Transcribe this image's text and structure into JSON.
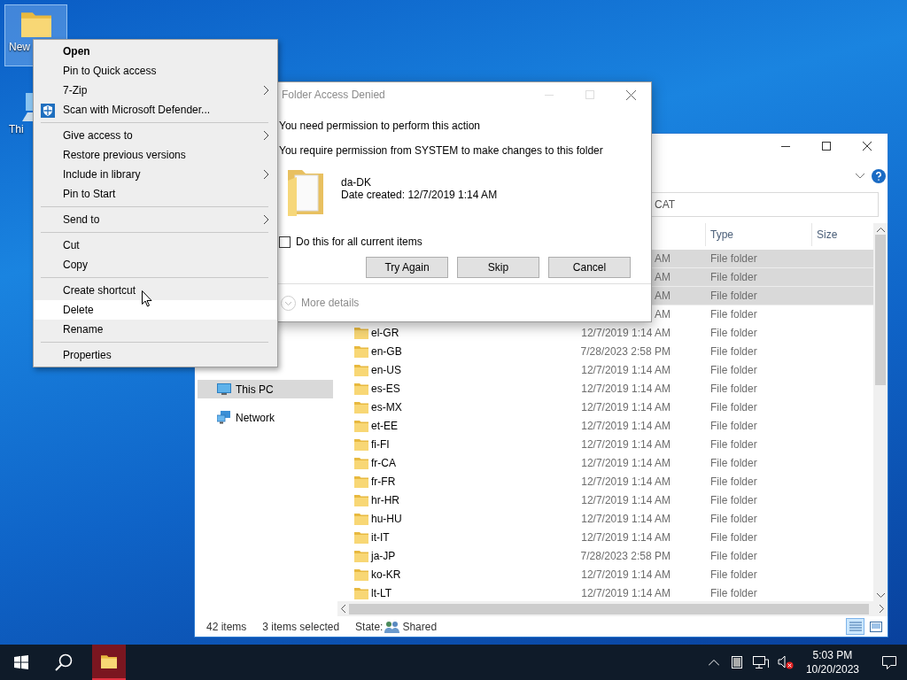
{
  "desktop": {
    "icons": [
      {
        "kind": "folder",
        "label": "New",
        "selected": true
      },
      {
        "kind": "computer",
        "label": "Thi",
        "selected": false
      }
    ]
  },
  "context_menu": {
    "groups": [
      {
        "items": [
          {
            "label": "Open",
            "default": true,
            "submenu": false,
            "highlighted": false,
            "has_icon": false
          },
          {
            "label": "Pin to Quick access",
            "default": false,
            "submenu": false,
            "highlighted": false,
            "has_icon": false
          },
          {
            "label": "7-Zip",
            "default": false,
            "submenu": true,
            "highlighted": false,
            "has_icon": false
          },
          {
            "label": "Scan with Microsoft Defender...",
            "default": false,
            "submenu": false,
            "highlighted": false,
            "has_icon": true
          }
        ]
      },
      {
        "items": [
          {
            "label": "Give access to",
            "default": false,
            "submenu": true,
            "highlighted": false,
            "has_icon": false
          },
          {
            "label": "Restore previous versions",
            "default": false,
            "submenu": false,
            "highlighted": false,
            "has_icon": false
          },
          {
            "label": "Include in library",
            "default": false,
            "submenu": true,
            "highlighted": false,
            "has_icon": false
          },
          {
            "label": "Pin to Start",
            "default": false,
            "submenu": false,
            "highlighted": false,
            "has_icon": false
          }
        ]
      },
      {
        "items": [
          {
            "label": "Send to",
            "default": false,
            "submenu": true,
            "highlighted": false,
            "has_icon": false
          }
        ]
      },
      {
        "items": [
          {
            "label": "Cut",
            "default": false,
            "submenu": false,
            "highlighted": false,
            "has_icon": false
          },
          {
            "label": "Copy",
            "default": false,
            "submenu": false,
            "highlighted": false,
            "has_icon": false
          }
        ]
      },
      {
        "items": [
          {
            "label": "Create shortcut",
            "default": false,
            "submenu": false,
            "highlighted": false,
            "has_icon": false
          },
          {
            "label": "Delete",
            "default": false,
            "submenu": false,
            "highlighted": true,
            "has_icon": false
          },
          {
            "label": "Rename",
            "default": false,
            "submenu": false,
            "highlighted": false,
            "has_icon": false
          }
        ]
      },
      {
        "items": [
          {
            "label": "Properties",
            "default": false,
            "submenu": false,
            "highlighted": false,
            "has_icon": false
          }
        ]
      }
    ]
  },
  "dialog": {
    "title": "Folder Access Denied",
    "heading": "You need permission to perform this action",
    "message": "You require permission from SYSTEM to make changes to this folder",
    "item_name": "da-DK",
    "item_date": "Date created: 12/7/2019 1:14 AM",
    "checkbox": {
      "label": "Do this for all current items",
      "checked": false
    },
    "buttons": [
      "Try Again",
      "Skip",
      "Cancel"
    ],
    "details": {
      "label": "More details",
      "expanded": false
    }
  },
  "explorer": {
    "address": "CAT",
    "columns": [
      "Type",
      "Size"
    ],
    "nav": [
      {
        "kind": "computer",
        "label": "This PC",
        "selected": true
      },
      {
        "kind": "network",
        "label": "Network",
        "selected": false
      }
    ],
    "rows": [
      {
        "date": "AM",
        "type": "File folder",
        "selected": true
      },
      {
        "date": "AM",
        "type": "File folder",
        "selected": true
      },
      {
        "date": "AM",
        "type": "File folder",
        "selected": true
      },
      {
        "date": "AM",
        "type": "File folder",
        "selected": false
      },
      {
        "name": "el-GR",
        "date": "12/7/2019 1:14 AM",
        "type": "File folder",
        "selected": false
      },
      {
        "name": "en-GB",
        "date": "7/28/2023 2:58 PM",
        "type": "File folder",
        "selected": false
      },
      {
        "name": "en-US",
        "date": "12/7/2019 1:14 AM",
        "type": "File folder",
        "selected": false
      },
      {
        "name": "es-ES",
        "date": "12/7/2019 1:14 AM",
        "type": "File folder",
        "selected": false
      },
      {
        "name": "es-MX",
        "date": "12/7/2019 1:14 AM",
        "type": "File folder",
        "selected": false
      },
      {
        "name": "et-EE",
        "date": "12/7/2019 1:14 AM",
        "type": "File folder",
        "selected": false
      },
      {
        "name": "fi-FI",
        "date": "12/7/2019 1:14 AM",
        "type": "File folder",
        "selected": false
      },
      {
        "name": "fr-CA",
        "date": "12/7/2019 1:14 AM",
        "type": "File folder",
        "selected": false
      },
      {
        "name": "fr-FR",
        "date": "12/7/2019 1:14 AM",
        "type": "File folder",
        "selected": false
      },
      {
        "name": "hr-HR",
        "date": "12/7/2019 1:14 AM",
        "type": "File folder",
        "selected": false
      },
      {
        "name": "hu-HU",
        "date": "12/7/2019 1:14 AM",
        "type": "File folder",
        "selected": false
      },
      {
        "name": "it-IT",
        "date": "12/7/2019 1:14 AM",
        "type": "File folder",
        "selected": false
      },
      {
        "name": "ja-JP",
        "date": "7/28/2023 2:58 PM",
        "type": "File folder",
        "selected": false
      },
      {
        "name": "ko-KR",
        "date": "12/7/2019 1:14 AM",
        "type": "File folder",
        "selected": false
      },
      {
        "name": "lt-LT",
        "date": "12/7/2019 1:14 AM",
        "type": "File folder",
        "selected": false
      }
    ],
    "status": {
      "count": "42 items",
      "selection": "3 items selected",
      "state_label": "State:",
      "state_value": "Shared"
    }
  },
  "taskbar": {
    "apps": [
      {
        "kind": "folder",
        "attention": true
      }
    ],
    "time": "5:03 PM",
    "date": "10/20/2023"
  }
}
